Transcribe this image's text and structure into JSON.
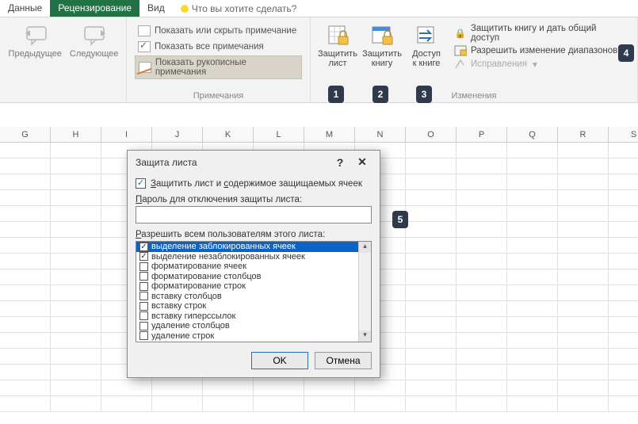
{
  "tabs": {
    "data": "Данные",
    "review": "Рецензирование",
    "view": "Вид",
    "tell": "Что вы хотите сделать?"
  },
  "nav": {
    "prev": "Предыдущее",
    "next": "Следующее"
  },
  "comments": {
    "show_hide": "Показать или скрыть примечание",
    "show_all": "Показать все примечания",
    "show_ink": "Показать рукописные примечания",
    "group": "Примечания"
  },
  "protect": {
    "sheet_l1": "Защитить",
    "sheet_l2": "лист",
    "book_l1": "Защитить",
    "book_l2": "книгу",
    "share_l1": "Доступ",
    "share_l2": "к книге"
  },
  "changes": {
    "protect_share": "Защитить книгу и дать общий доступ",
    "allow_ranges": "Разрешить изменение диапазонов",
    "track": "Исправления",
    "group": "Изменения"
  },
  "callouts": {
    "c1": "1",
    "c2": "2",
    "c3": "3",
    "c4": "4",
    "c5": "5"
  },
  "cols": [
    "G",
    "H",
    "I",
    "J",
    "K",
    "L",
    "M",
    "N",
    "O",
    "P",
    "Q",
    "R",
    "S"
  ],
  "dialog": {
    "title": "Защита листа",
    "help": "?",
    "close": "✕",
    "protect_contents": "Защитить лист и содержимое защищаемых ячеек",
    "password_label_pre": "",
    "password_label": "Пароль для отключения защиты листа:",
    "password_value": "",
    "allow_label": "Разрешить всем пользователям этого листа:",
    "perms": [
      {
        "label": "выделение заблокированных ячеек",
        "checked": true,
        "selected": true
      },
      {
        "label": "выделение незаблокированных ячеек",
        "checked": true
      },
      {
        "label": "форматирование ячеек"
      },
      {
        "label": "форматирование столбцов"
      },
      {
        "label": "форматирование строк"
      },
      {
        "label": "вставку столбцов"
      },
      {
        "label": "вставку строк"
      },
      {
        "label": "вставку гиперссылок"
      },
      {
        "label": "удаление столбцов"
      },
      {
        "label": "удаление строк"
      }
    ],
    "ok": "OK",
    "cancel": "Отмена"
  }
}
